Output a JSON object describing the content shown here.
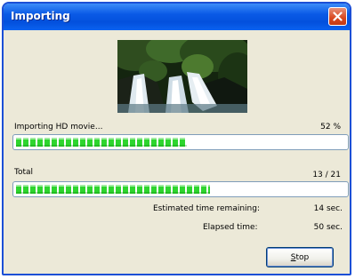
{
  "window": {
    "title": "Importing"
  },
  "current": {
    "label": "Importing HD movie...",
    "percent_text": "52 %",
    "progress": 0.52
  },
  "total": {
    "label": "Total",
    "count_text": "13 / 21",
    "progress": 0.59
  },
  "time": {
    "remaining_label": "Estimated time remaining:",
    "remaining_value": "14 sec.",
    "elapsed_label": "Elapsed time:",
    "elapsed_value": "50 sec."
  },
  "buttons": {
    "stop_label_accel": "S",
    "stop_label_rest": "top"
  },
  "colors": {
    "title_bar": "#0a5ae6",
    "progress_fill": "#2ed52e",
    "close_button": "#d9471f"
  }
}
